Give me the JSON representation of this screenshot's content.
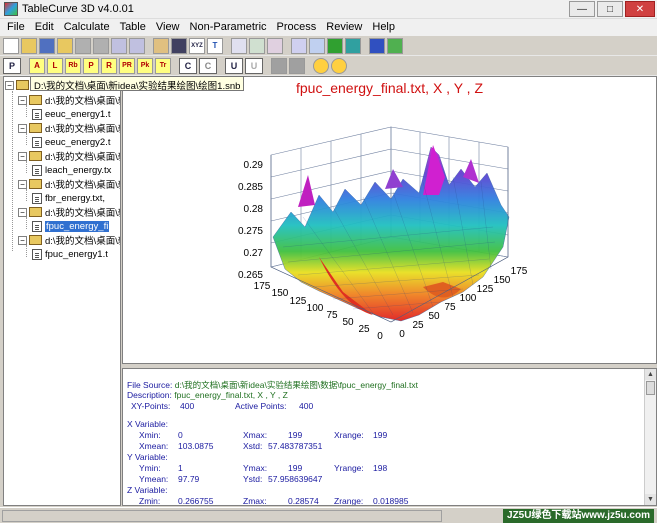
{
  "window": {
    "title": "TableCurve 3D v4.0.01"
  },
  "menu": [
    "File",
    "Edit",
    "Calculate",
    "Table",
    "View",
    "Non-Parametric",
    "Process",
    "Review",
    "Help"
  ],
  "toolbar2_text": {
    "x": "P",
    "a": "A",
    "l": "L",
    "rb": "Rb",
    "p": "P",
    "r": "R",
    "pr": "PR",
    "pk": "Pk",
    "tr": "Tr",
    "c1": "C",
    "c2": "C",
    "u1": "U",
    "u2": "U",
    "xyz": "XYZ",
    "t": "T"
  },
  "tree": {
    "root_tooltip": "D:\\我的文档\\桌面\\新idea\\实验结果绘图\\绘图1.snb",
    "items": [
      {
        "label": "d:\\我的文档\\桌面\\新",
        "type": "folder"
      },
      {
        "label": "eeuc_energy1.t",
        "type": "file"
      },
      {
        "label": "d:\\我的文档\\桌面\\新",
        "type": "folder"
      },
      {
        "label": "eeuc_energy2.t",
        "type": "file"
      },
      {
        "label": "d:\\我的文档\\桌面\\新",
        "type": "folder"
      },
      {
        "label": "leach_energy.tx",
        "type": "file"
      },
      {
        "label": "d:\\我的文档\\桌面\\新",
        "type": "folder"
      },
      {
        "label": "fbr_energy.txt,",
        "type": "file"
      },
      {
        "label": "d:\\我的文档\\桌面\\新",
        "type": "folder"
      },
      {
        "label": "fpuc_energy_fi",
        "type": "file",
        "selected": true
      },
      {
        "label": "d:\\我的文档\\桌面\\新",
        "type": "folder"
      },
      {
        "label": "fpuc_energy1.t",
        "type": "file"
      }
    ]
  },
  "plot": {
    "title": "fpuc_energy_final.txt, X , Y , Z",
    "z_ticks": [
      "0.29",
      "0.285",
      "0.28",
      "0.275",
      "0.27",
      "0.265"
    ],
    "x_ticks": [
      "175",
      "150",
      "125",
      "100",
      "75",
      "50",
      "25",
      "0"
    ],
    "y_ticks": [
      "0",
      "25",
      "50",
      "75",
      "100",
      "125",
      "150",
      "175"
    ]
  },
  "info": {
    "file_source_label": "File Source:",
    "file_source": "d:\\我的文档\\桌面\\新idea\\实验结果绘图\\数据\\fpuc_energy_final.txt",
    "description_label": "Description:",
    "description": "fpuc_energy_final.txt, X , Y , Z",
    "xy_points_label": "XY-Points:",
    "xy_points": "400",
    "active_points_label": "Active Points:",
    "active_points": "400",
    "x_var": {
      "header": "X Variable:",
      "min_l": "Xmin:",
      "min": "0",
      "max_l": "Xmax:",
      "max": "199",
      "range_l": "Xrange:",
      "range": "199",
      "mean_l": "Xmean:",
      "mean": "103.0875",
      "std_l": "Xstd:",
      "std": "57.483787351"
    },
    "y_var": {
      "header": "Y Variable:",
      "min_l": "Ymin:",
      "min": "1",
      "max_l": "Ymax:",
      "max": "199",
      "range_l": "Yrange:",
      "range": "198",
      "mean_l": "Ymean:",
      "mean": "97.79",
      "std_l": "Ystd:",
      "std": "57.958639647"
    },
    "z_var": {
      "header": "Z Variable:",
      "min_l": "Zmin:",
      "min": "0.266755",
      "max_l": "Zmax:",
      "max": "0.28574",
      "range_l": "Zrange:",
      "range": "0.018985"
    }
  },
  "watermark": "JZ5U绿色下载站www.jz5u.com"
}
